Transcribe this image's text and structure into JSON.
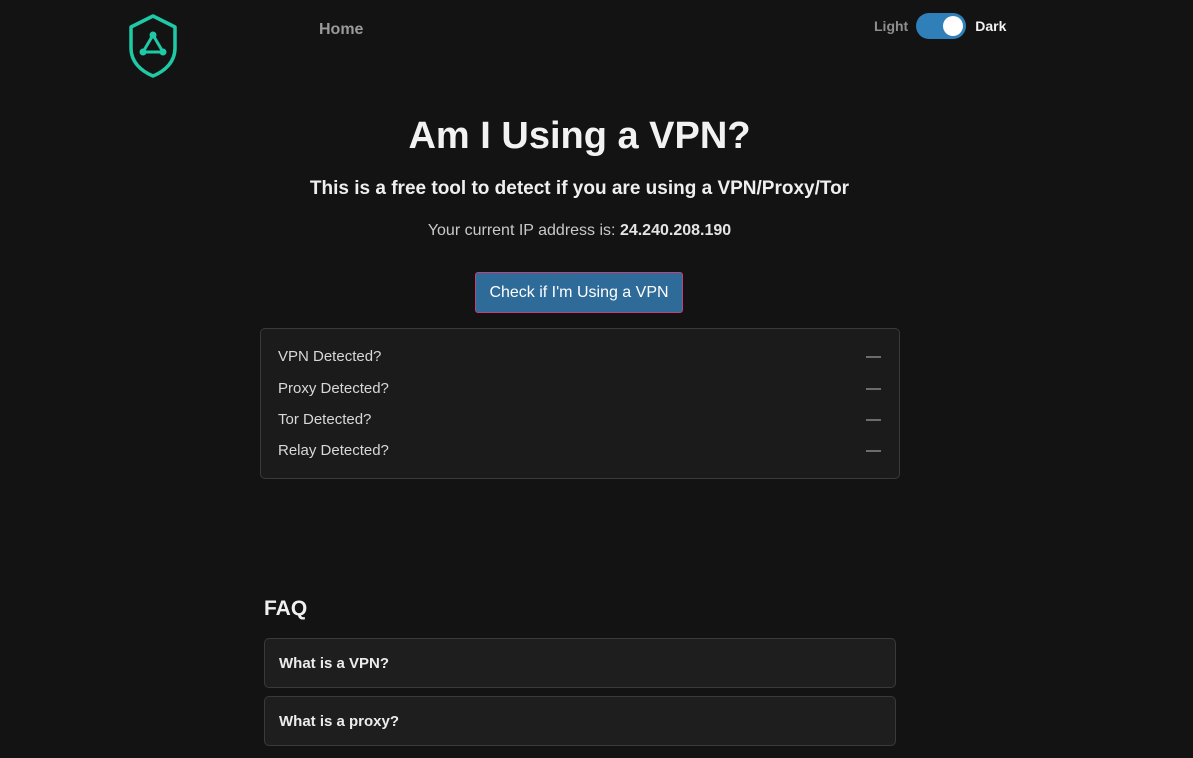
{
  "brand": {
    "logo_icon": "shield-network-icon",
    "accent_color": "#1fc9a6"
  },
  "nav": {
    "home_label": "Home"
  },
  "theme": {
    "light_label": "Light",
    "dark_label": "Dark",
    "selected": "Dark",
    "switch_color": "#2f7fb8"
  },
  "hero": {
    "title": "Am I Using a VPN?",
    "subtitle": "This is a free tool to detect if you are using a VPN/Proxy/Tor",
    "ip_prefix": "Your current IP address is: ",
    "ip_address": "24.240.208.190"
  },
  "check_button": {
    "label": "Check if I'm Using a VPN",
    "color": "#2e6b99"
  },
  "results": [
    {
      "label": "VPN Detected?",
      "value": "—"
    },
    {
      "label": "Proxy Detected?",
      "value": "—"
    },
    {
      "label": "Tor Detected?",
      "value": "—"
    },
    {
      "label": "Relay Detected?",
      "value": "—"
    }
  ],
  "faq": {
    "heading": "FAQ",
    "items": [
      {
        "question": "What is a VPN?"
      },
      {
        "question": "What is a proxy?"
      }
    ]
  }
}
